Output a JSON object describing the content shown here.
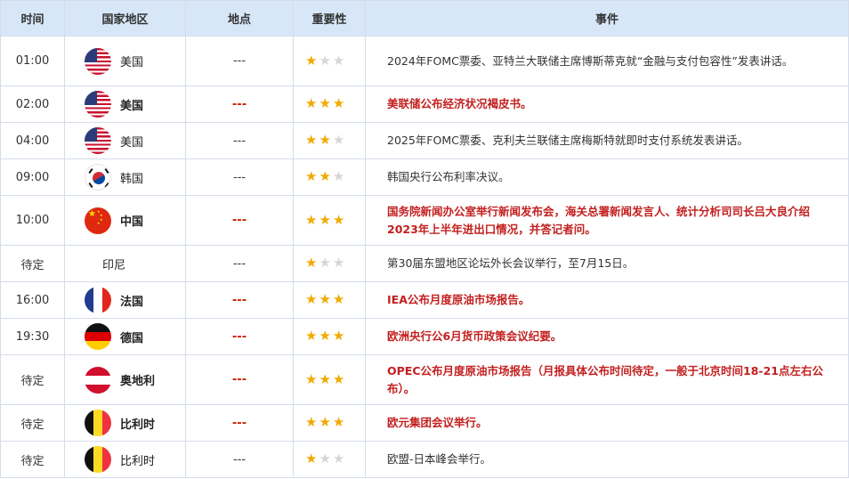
{
  "headers": {
    "time": "时间",
    "country": "国家地区",
    "place": "地点",
    "importance": "重要性",
    "event": "事件"
  },
  "colors": {
    "header_bg": "#d7e7f8",
    "important_text": "#c31f1f",
    "star_on": "#f2a900",
    "star_off": "#d6d6d6"
  },
  "rows": [
    {
      "time": "01:00",
      "country": "美国",
      "flag": "us-flag-icon",
      "place": "---",
      "stars": 1,
      "important": false,
      "event": "2024年FOMC票委、亚特兰大联储主席博斯蒂克就“金融与支付包容性”发表讲话。"
    },
    {
      "time": "02:00",
      "country": "美国",
      "flag": "us-flag-icon",
      "place": "---",
      "stars": 3,
      "important": true,
      "event": "美联储公布经济状况褐皮书。"
    },
    {
      "time": "04:00",
      "country": "美国",
      "flag": "us-flag-icon",
      "place": "---",
      "stars": 2,
      "important": false,
      "event": "2025年FOMC票委、克利夫兰联储主席梅斯特就即时支付系统发表讲话。"
    },
    {
      "time": "09:00",
      "country": "韩国",
      "flag": "kr-flag-icon",
      "place": "---",
      "stars": 2,
      "important": false,
      "event": "韩国央行公布利率决议。"
    },
    {
      "time": "10:00",
      "country": "中国",
      "flag": "cn-flag-icon",
      "place": "---",
      "stars": 3,
      "important": true,
      "event": "国务院新闻办公室举行新闻发布会，海关总署新闻发言人、统计分析司司长吕大良介绍2023年上半年进出口情况，并答记者问。"
    },
    {
      "time": "待定",
      "country": "印尼",
      "flag": "",
      "place": "---",
      "stars": 1,
      "important": false,
      "event": "第30届东盟地区论坛外长会议举行，至7月15日。"
    },
    {
      "time": "16:00",
      "country": "法国",
      "flag": "fr-flag-icon",
      "place": "---",
      "stars": 3,
      "important": true,
      "event": "IEA公布月度原油市场报告。"
    },
    {
      "time": "19:30",
      "country": "德国",
      "flag": "de-flag-icon",
      "place": "---",
      "stars": 3,
      "important": true,
      "event": "欧洲央行公6月货币政策会议纪要。"
    },
    {
      "time": "待定",
      "country": "奥地利",
      "flag": "at-flag-icon",
      "place": "---",
      "stars": 3,
      "important": true,
      "event": "OPEC公布月度原油市场报告（月报具体公布时间待定，一般于北京时间18-21点左右公布）。"
    },
    {
      "time": "待定",
      "country": "比利时",
      "flag": "be-flag-icon",
      "place": "---",
      "stars": 3,
      "important": true,
      "event": "欧元集团会议举行。"
    },
    {
      "time": "待定",
      "country": "比利时",
      "flag": "be-flag-icon",
      "place": "---",
      "stars": 1,
      "important": false,
      "event": "欧盟-日本峰会举行。"
    }
  ]
}
